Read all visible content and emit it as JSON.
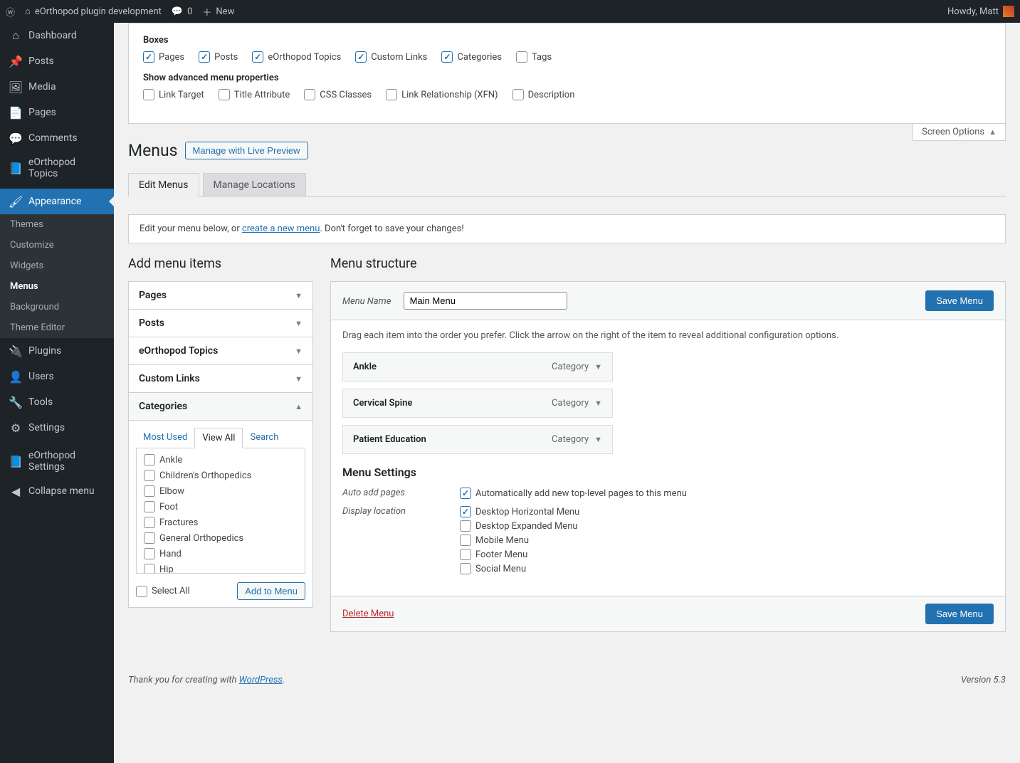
{
  "adminbar": {
    "site_name": "eOrthopod plugin development",
    "comment_count": "0",
    "new_label": "New",
    "greeting": "Howdy, Matt"
  },
  "sidebar": {
    "items": [
      {
        "icon": "⌂",
        "label": "Dashboard"
      },
      {
        "icon": "📌",
        "label": "Posts"
      },
      {
        "icon": "🖼",
        "label": "Media"
      },
      {
        "icon": "📄",
        "label": "Pages"
      },
      {
        "icon": "💬",
        "label": "Comments"
      },
      {
        "icon": "📘",
        "label": "eOrthopod Topics"
      },
      {
        "icon": "🖌",
        "label": "Appearance",
        "active": true
      },
      {
        "icon": "🔌",
        "label": "Plugins"
      },
      {
        "icon": "👤",
        "label": "Users"
      },
      {
        "icon": "🔧",
        "label": "Tools"
      },
      {
        "icon": "⚙",
        "label": "Settings"
      },
      {
        "icon": "📘",
        "label": "eOrthopod Settings"
      },
      {
        "icon": "◀",
        "label": "Collapse menu"
      }
    ],
    "appearance_submenu": [
      "Themes",
      "Customize",
      "Widgets",
      "Menus",
      "Background",
      "Theme Editor"
    ],
    "appearance_current": "Menus"
  },
  "screen_options": {
    "tab_label": "Screen Options",
    "boxes_heading": "Boxes",
    "boxes": [
      {
        "label": "Pages",
        "checked": true
      },
      {
        "label": "Posts",
        "checked": true
      },
      {
        "label": "eOrthopod Topics",
        "checked": true
      },
      {
        "label": "Custom Links",
        "checked": true
      },
      {
        "label": "Categories",
        "checked": true
      },
      {
        "label": "Tags",
        "checked": false
      }
    ],
    "advanced_heading": "Show advanced menu properties",
    "advanced": [
      {
        "label": "Link Target",
        "checked": false
      },
      {
        "label": "Title Attribute",
        "checked": false
      },
      {
        "label": "CSS Classes",
        "checked": false
      },
      {
        "label": "Link Relationship (XFN)",
        "checked": false
      },
      {
        "label": "Description",
        "checked": false
      }
    ]
  },
  "page": {
    "title": "Menus",
    "live_preview_btn": "Manage with Live Preview",
    "tabs": [
      "Edit Menus",
      "Manage Locations"
    ],
    "active_tab": "Edit Menus",
    "notice_prefix": "Edit your menu below, or ",
    "notice_link": "create a new menu",
    "notice_suffix": ". Don't forget to save your changes!"
  },
  "add_items": {
    "heading": "Add menu items",
    "sections": [
      "Pages",
      "Posts",
      "eOrthopod Topics",
      "Custom Links",
      "Categories"
    ],
    "open_section": "Categories",
    "inner_tabs": [
      "Most Used",
      "View All",
      "Search"
    ],
    "inner_active": "View All",
    "categories": [
      "Ankle",
      "Children's Orthopedics",
      "Elbow",
      "Foot",
      "Fractures",
      "General Orthopedics",
      "Hand",
      "Hip"
    ],
    "select_all": "Select All",
    "add_btn": "Add to Menu"
  },
  "structure": {
    "heading": "Menu structure",
    "menu_name_label": "Menu Name",
    "menu_name_value": "Main Menu",
    "save_btn": "Save Menu",
    "hint": "Drag each item into the order you prefer. Click the arrow on the right of the item to reveal additional configuration options.",
    "items": [
      {
        "label": "Ankle",
        "type": "Category"
      },
      {
        "label": "Cervical Spine",
        "type": "Category"
      },
      {
        "label": "Patient Education",
        "type": "Category"
      }
    ],
    "settings_heading": "Menu Settings",
    "auto_add_label": "Auto add pages",
    "auto_add_option": "Automatically add new top-level pages to this menu",
    "auto_add_checked": true,
    "display_loc_label": "Display location",
    "locations": [
      {
        "label": "Desktop Horizontal Menu",
        "checked": true
      },
      {
        "label": "Desktop Expanded Menu",
        "checked": false
      },
      {
        "label": "Mobile Menu",
        "checked": false
      },
      {
        "label": "Footer Menu",
        "checked": false
      },
      {
        "label": "Social Menu",
        "checked": false
      }
    ],
    "delete_link": "Delete Menu"
  },
  "footer": {
    "thanks_prefix": "Thank you for creating with ",
    "wp_link": "WordPress",
    "thanks_suffix": ".",
    "version": "Version 5.3"
  }
}
